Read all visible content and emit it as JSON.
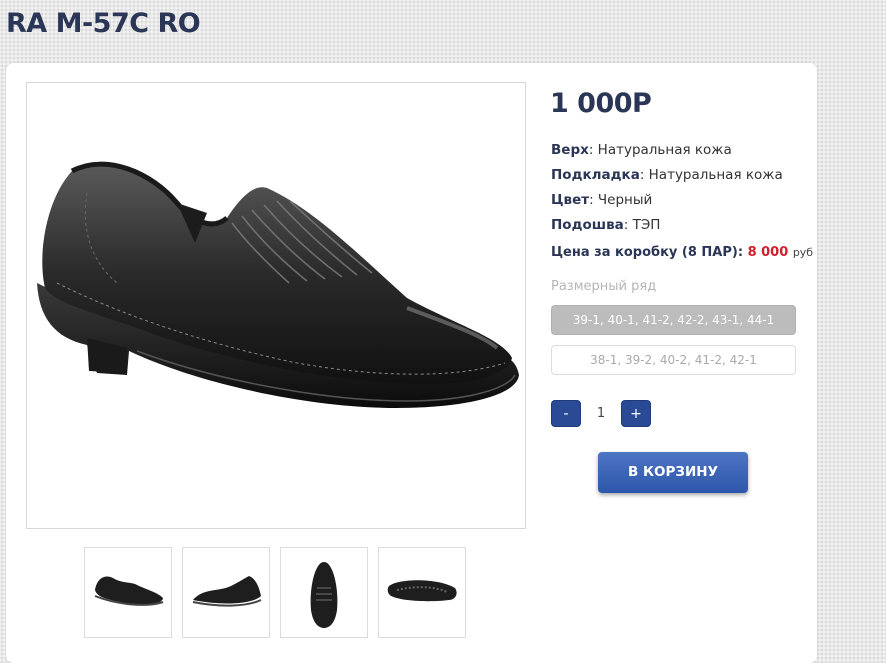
{
  "product": {
    "title": "RA M-57C RO",
    "price": "1 000Р"
  },
  "specs": [
    {
      "label": "Верх",
      "value": ": Натуральная кожа"
    },
    {
      "label": "Подкладка",
      "value": ": Натуральная кожа"
    },
    {
      "label": "Цвет",
      "value": ": Черный"
    },
    {
      "label": "Подошва",
      "value": ": ТЭП"
    }
  ],
  "box_price": {
    "label": "Цена за коробку (8 ПАР):",
    "value": "8 000",
    "unit": "руб"
  },
  "sizes": {
    "label": "Размерный ряд",
    "options": [
      {
        "text": "39-1, 40-1, 41-2, 42-2, 43-1, 44-1",
        "selected": true
      },
      {
        "text": "38-1, 39-2, 40-2, 41-2, 42-1",
        "selected": false
      }
    ]
  },
  "quantity": {
    "minus": "-",
    "value": "1",
    "plus": "+"
  },
  "cart_button": "В КОРЗИНУ",
  "gallery": {
    "images": [
      "black-loafer-side-view",
      "black-loafer-three-quarter-view",
      "black-loafer-front-view",
      "black-loafer-sole-view"
    ]
  },
  "colors": {
    "title": "#2b3656",
    "accent_button": "#2a4a96",
    "box_price_red": "#d0202e"
  }
}
